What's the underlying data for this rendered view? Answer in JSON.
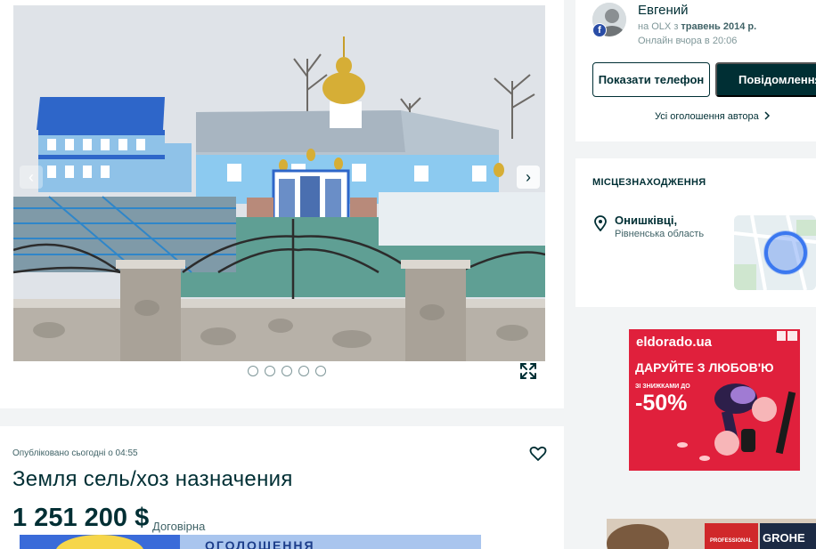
{
  "gallery": {
    "prev_icon": "chevron-left-icon",
    "next_icon": "chevron-right-icon",
    "dot_count": 5,
    "fullscreen_icon": "expand-icon"
  },
  "listing": {
    "posted": "Опубліковано сьогодні о 04:55",
    "title": "Земля сель/хоз назначения",
    "price": "1 251 200 $",
    "negotiable": "Договірна",
    "banner_text": "ОГОЛОШЕННЯ"
  },
  "seller": {
    "name": "Евгений",
    "since_prefix": "на OLX з",
    "since_date": "травень 2014 р.",
    "online": "Онлайн вчора в 20:06",
    "phone_button": "Показати телефон",
    "message_button": "Повідомлення",
    "all_ads": "Усі оголошення автора"
  },
  "location": {
    "heading": "МІСЦЕЗНАХОДЖЕННЯ",
    "city": "Онишківці,",
    "region": "Рівненська область"
  },
  "ads": {
    "eldorado_logo": "eldorado.ua",
    "eldorado_headline": "ДАРУЙТЕ З ЛЮБОВ'Ю",
    "eldorado_small": "ЗІ ЗНИЖКАМИ ДО",
    "eldorado_discount": "-50%",
    "grohe_brand": "GROHE",
    "grohe_tag": "PROFESSIONAL"
  },
  "colors": {
    "brand_dark": "#002f34",
    "eldorado_red": "#e0203c",
    "sky": "#dfe3e8",
    "roof_blue": "#2f6fd1"
  }
}
